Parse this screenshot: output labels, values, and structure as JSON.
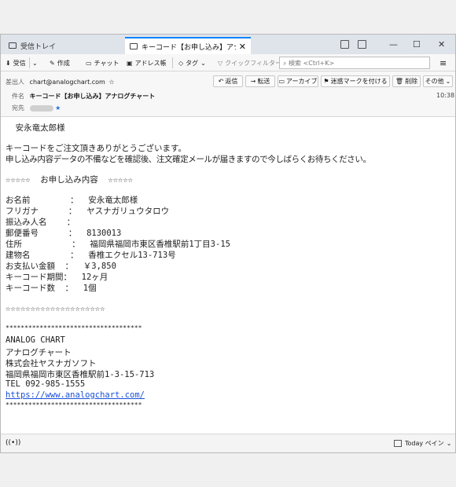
{
  "tabs": {
    "inbox": "受信トレイ",
    "message": "キーコード【お申し込み】アナログチ"
  },
  "window_controls": {
    "minimize": "—",
    "maximize": "☐",
    "close": "✕"
  },
  "toolbar": {
    "get_mail": "受信",
    "write": "作成",
    "chat": "チャット",
    "address_book": "アドレス帳",
    "tag": "タグ",
    "quick_filter": "クイックフィルター",
    "search_placeholder": "検索 <Ctrl+K>",
    "menu": "≡"
  },
  "header": {
    "from_label": "差出人",
    "from_value": "chart@analogchart.com",
    "subject_label": "件名",
    "subject_value": "キーコード【お申し込み】アナログチャート",
    "to_label": "宛先",
    "time": "10:38",
    "buttons": {
      "reply": "返信",
      "forward": "転送",
      "archive": "アーカイブ",
      "junk": "迷惑マークを付ける",
      "delete": "削除",
      "other": "その他"
    }
  },
  "body": {
    "lines": [
      "  安永竜太郎様",
      "キーコードをご注文頂きありがとうございます。",
      "申し込み内容データの不備などを確認後、注文確定メールが届きますので今しばらくお待ちください。",
      "☆☆☆☆☆  お申し込み内容  ☆☆☆☆☆",
      "お名前        ：  安永竜太郎様",
      "フリガナ      ：  ヤスナガリュウタロウ",
      "振込み人名    ：",
      "郵便番号      ：  8130013",
      "住所          ：  福岡県福岡市東区香椎駅前1丁目3-15",
      "建物名        ：  香椎エクセル13-713号",
      "お支払い金額  ：  ￥3,850",
      "キーコード期間：  12ヶ月",
      "キーコード数  ：  1個",
      "☆☆☆☆☆☆☆☆☆☆☆☆☆☆☆☆☆☆☆☆",
      "************************************",
      "ANALOG CHART",
      "アナログチャート",
      "株式会社ヤスナガソフト",
      "福岡県福岡市東区香椎駅前1-3-15-713",
      "TEL 092-985-1555",
      "https://www.analogchart.com/",
      "************************************"
    ]
  },
  "status": {
    "today_pane": "Today ペイン"
  },
  "colors": {
    "accent": "#0a84ff",
    "link": "#1a4fd6"
  }
}
